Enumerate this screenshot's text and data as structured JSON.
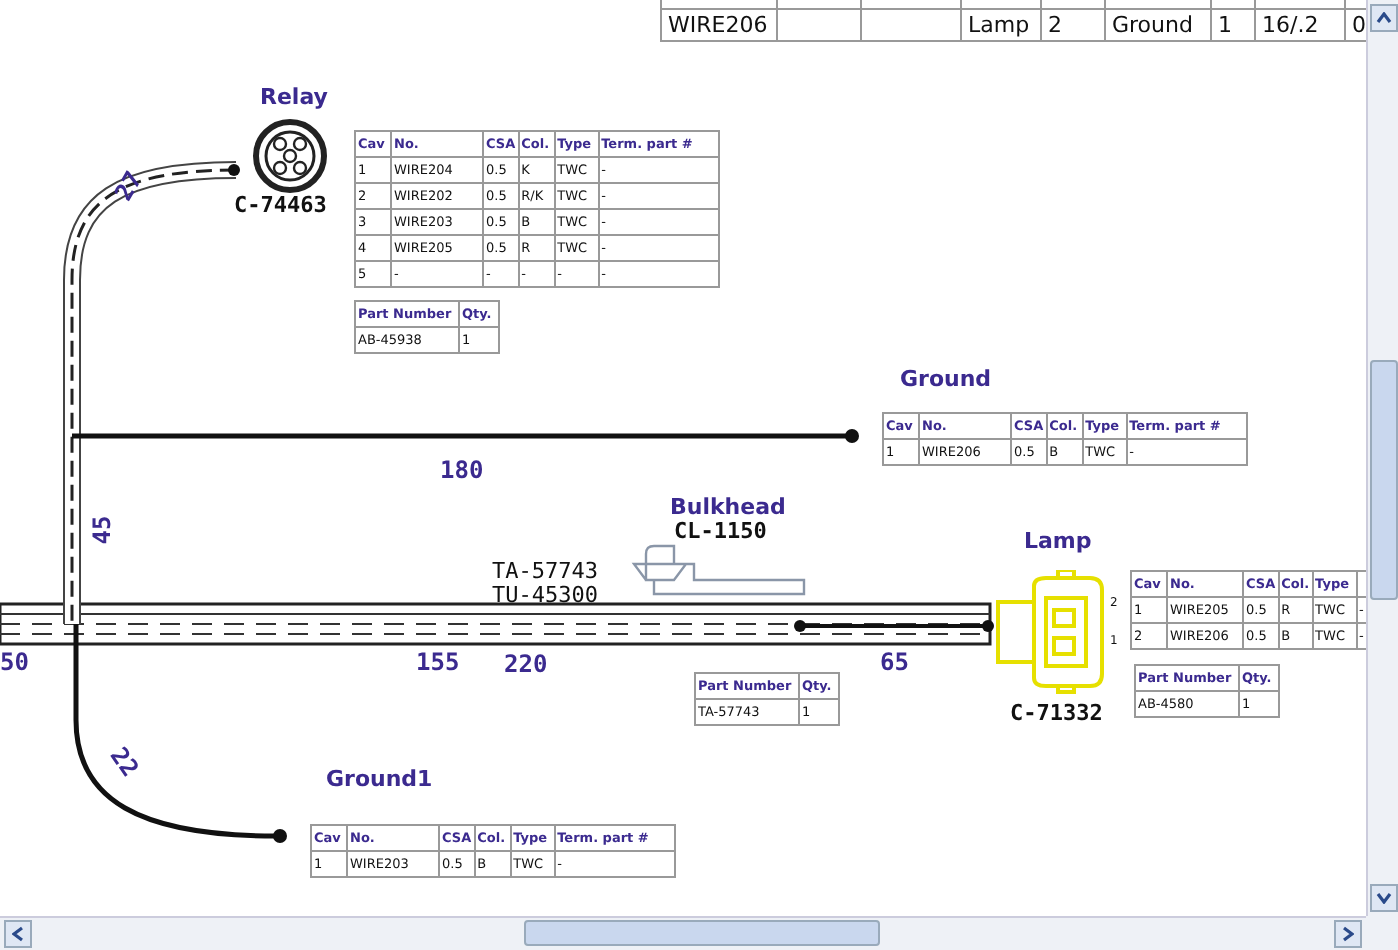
{
  "top_table": {
    "rows": [
      [
        "WIRE206",
        null,
        null,
        "Lamp",
        "2",
        "Ground",
        "1",
        "16/.2",
        "0"
      ]
    ]
  },
  "harness": {
    "labels": [
      "TA-57743",
      "TU-45300"
    ]
  },
  "measurements": [
    "27",
    "180",
    "45",
    "50",
    "155",
    "220",
    "65",
    "22"
  ],
  "connectors": [
    {
      "kind": "round",
      "name": "Relay",
      "code": "C-74463",
      "wire_table": {
        "columns": [
          "Cav",
          "No.",
          "CSA",
          "Col.",
          "Type",
          "Term. part #"
        ],
        "rows": [
          [
            "1",
            "WIRE204",
            "0.5",
            "K",
            "TWC",
            "-"
          ],
          [
            "2",
            "WIRE202",
            "0.5",
            "R/K",
            "TWC",
            "-"
          ],
          [
            "3",
            "WIRE203",
            "0.5",
            "B",
            "TWC",
            "-"
          ],
          [
            "4",
            "WIRE205",
            "0.5",
            "R",
            "TWC",
            "-"
          ],
          [
            "5",
            "-",
            "-",
            "-",
            "-",
            "-"
          ]
        ]
      },
      "part_table": {
        "columns": [
          "Part Number",
          "Qty."
        ],
        "rows": [
          [
            "AB-45938",
            "1"
          ]
        ]
      }
    },
    {
      "kind": "none",
      "name": "Ground",
      "wire_table": {
        "columns": [
          "Cav",
          "No.",
          "CSA",
          "Col.",
          "Type",
          "Term. part #"
        ],
        "rows": [
          [
            "1",
            "WIRE206",
            "0.5",
            "B",
            "TWC",
            "-"
          ]
        ]
      }
    },
    {
      "kind": "bulkhead",
      "name": "Bulkhead",
      "code": "CL-1150",
      "part_table": {
        "columns": [
          "Part Number",
          "Qty."
        ],
        "rows": [
          [
            "TA-57743",
            "1"
          ]
        ]
      }
    },
    {
      "kind": "lamp",
      "name": "Lamp",
      "code": "C-71332",
      "pins": [
        "2",
        "1"
      ],
      "wire_table": {
        "columns": [
          "Cav",
          "No.",
          "CSA",
          "Col.",
          "Type",
          null
        ],
        "rows": [
          [
            "1",
            "WIRE205",
            "0.5",
            "R",
            "TWC",
            "-"
          ],
          [
            "2",
            "WIRE206",
            "0.5",
            "B",
            "TWC",
            "-"
          ]
        ]
      },
      "part_table": {
        "columns": [
          "Part Number",
          "Qty."
        ],
        "rows": [
          [
            "AB-4580",
            "1"
          ]
        ]
      }
    },
    {
      "kind": "none",
      "name": "Ground1",
      "wire_table": {
        "columns": [
          "Cav",
          "No.",
          "CSA",
          "Col.",
          "Type",
          "Term. part #"
        ],
        "rows": [
          [
            "1",
            "WIRE203",
            "0.5",
            "B",
            "TWC",
            "-"
          ]
        ]
      }
    }
  ]
}
